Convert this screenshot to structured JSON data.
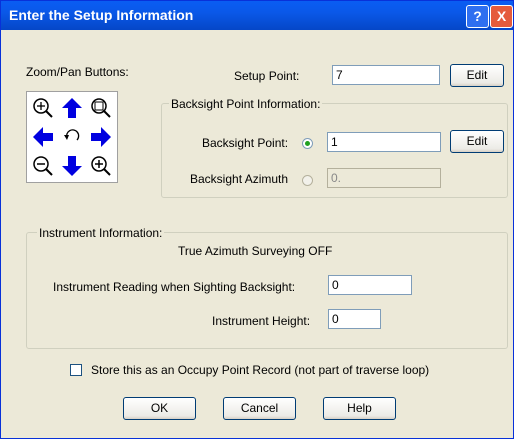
{
  "window": {
    "title": "Enter the Setup Information",
    "help_glyph": "?",
    "close_glyph": "X"
  },
  "zoom": {
    "label": "Zoom/Pan Buttons:"
  },
  "setup": {
    "label": "Setup Point:",
    "value": "7",
    "edit_label": "Edit"
  },
  "backsight": {
    "group_title": "Backsight Point Information:",
    "point_label": "Backsight Point:",
    "point_value": "1",
    "point_selected": true,
    "edit_label": "Edit",
    "azimuth_label": "Backsight Azimuth",
    "azimuth_value": "0."
  },
  "instrument": {
    "group_title": "Instrument Information:",
    "mode_text": "True Azimuth Surveying OFF",
    "reading_label": "Instrument Reading when Sighting Backsight:",
    "reading_value": "0",
    "height_label": "Instrument Height:",
    "height_value": "0"
  },
  "occupy": {
    "label": "Store this as an Occupy Point Record (not part of traverse loop)",
    "checked": false
  },
  "buttons": {
    "ok": "OK",
    "cancel": "Cancel",
    "help": "Help"
  }
}
